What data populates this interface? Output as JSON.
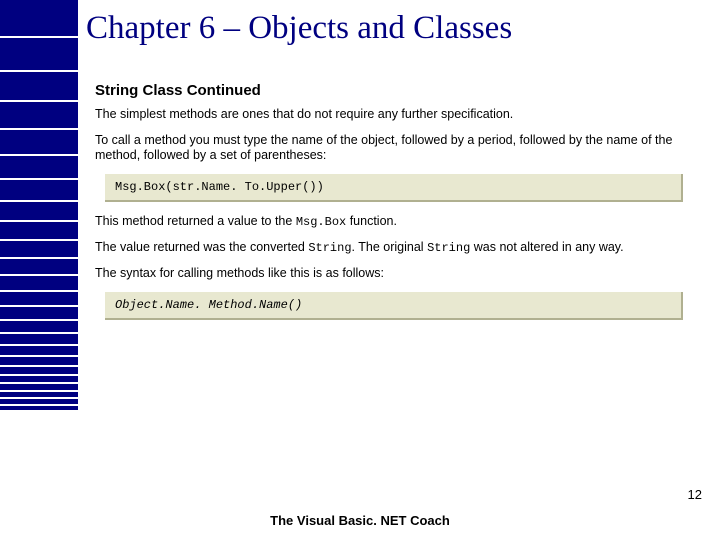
{
  "sidebar": {
    "blocks": [
      36,
      32,
      28,
      26,
      24,
      22,
      20,
      18,
      17,
      16,
      15,
      14,
      13,
      12,
      11,
      10,
      9,
      8,
      7,
      6,
      6,
      5,
      5,
      4
    ]
  },
  "title": "Chapter 6 – Objects and Classes",
  "section_heading": "String Class Continued",
  "para1": "The simplest methods are ones that do not require any further specification.",
  "para2": "To call a method you must type the name of the object, followed by a period, followed by the name of the method, followed by a set of parentheses:",
  "code1": "Msg.Box(str.Name. To.Upper())",
  "para3_pre": "This method returned a value to the ",
  "para3_mono": "Msg.Box",
  "para3_post": " function.",
  "para4_a": "The value returned was the converted ",
  "para4_b": "String",
  "para4_c": ". The original ",
  "para4_d": "String",
  "para4_e": " was not altered in any way.",
  "para5": "The syntax for calling methods like this is as follows:",
  "code2": "Object.Name. Method.Name()",
  "page_number": "12",
  "footer": "The Visual Basic. NET Coach"
}
